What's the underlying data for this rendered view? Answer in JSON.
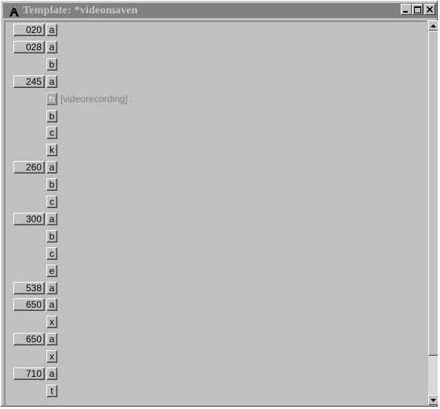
{
  "window": {
    "title": "Template: *videomaven",
    "minimize_glyph": "_",
    "maximize_glyph": "□",
    "close_glyph": "x"
  },
  "rows": [
    {
      "tag": "020",
      "sub": "a"
    },
    {
      "tag": "028",
      "sub": "a"
    },
    {
      "tag": "",
      "sub": "b"
    },
    {
      "tag": "245",
      "sub": "a"
    },
    {
      "tag": "",
      "sub": "h",
      "disabled": true,
      "text": "[videorecording] ."
    },
    {
      "tag": "",
      "sub": "b"
    },
    {
      "tag": "",
      "sub": "c"
    },
    {
      "tag": "",
      "sub": "k"
    },
    {
      "tag": "260",
      "sub": "a"
    },
    {
      "tag": "",
      "sub": "b"
    },
    {
      "tag": "",
      "sub": "c"
    },
    {
      "tag": "300",
      "sub": "a"
    },
    {
      "tag": "",
      "sub": "b"
    },
    {
      "tag": "",
      "sub": "c"
    },
    {
      "tag": "",
      "sub": "e"
    },
    {
      "tag": "538",
      "sub": "a"
    },
    {
      "tag": "650",
      "sub": "a"
    },
    {
      "tag": "",
      "sub": "x"
    },
    {
      "tag": "650",
      "sub": "a"
    },
    {
      "tag": "",
      "sub": "x"
    },
    {
      "tag": "710",
      "sub": "a"
    },
    {
      "tag": "",
      "sub": "t"
    }
  ],
  "scrollbar": {
    "position": 0.0
  }
}
